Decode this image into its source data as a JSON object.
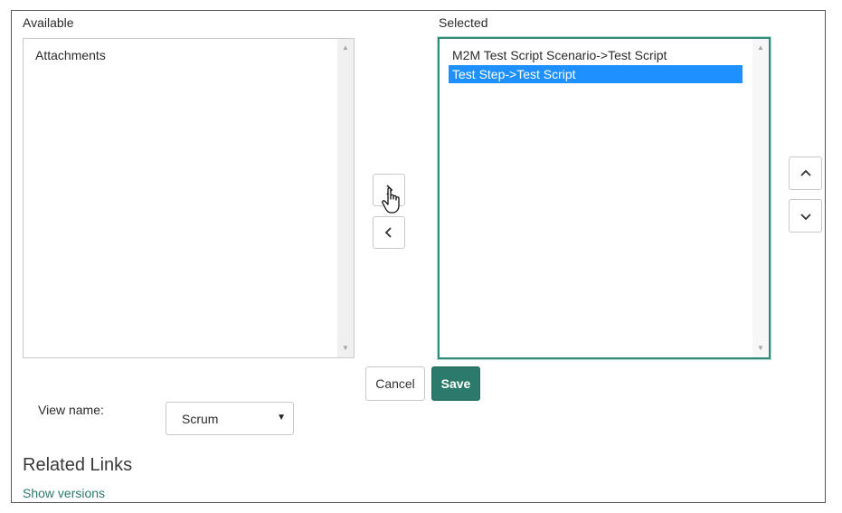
{
  "available": {
    "label": "Available",
    "items": [
      "Attachments"
    ]
  },
  "selected": {
    "label": "Selected",
    "items": [
      "M2M Test Script Scenario->Test Script",
      "Test Step->Test Script"
    ],
    "highlighted_index": 1
  },
  "actions": {
    "cancel_label": "Cancel",
    "save_label": "Save"
  },
  "view": {
    "label": "View name:",
    "value": "Scrum"
  },
  "related_links": {
    "title": "Related Links",
    "show_versions": "Show versions"
  },
  "colors": {
    "accent": "#2b7a6b",
    "highlight": "#1e90ff"
  }
}
